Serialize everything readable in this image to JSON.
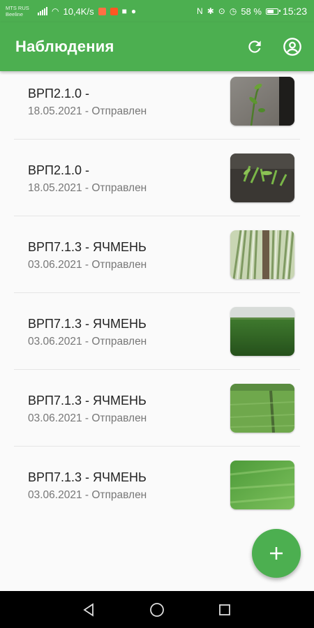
{
  "status_bar": {
    "carrier_line1": "MTS RUS",
    "carrier_line2": "Beeline",
    "network_speed": "10,4K/s",
    "battery_percent": "58 %",
    "time": "15:23",
    "icons": [
      "signal-icon",
      "wifi-icon",
      "notification-icon",
      "video-icon",
      "nfc-icon",
      "bluetooth-icon",
      "location-icon",
      "alarm-icon",
      "battery-icon"
    ]
  },
  "app_bar": {
    "title": "Наблюдения",
    "actions": [
      "refresh-icon",
      "account-icon"
    ]
  },
  "observations": [
    {
      "title": "ВРП2.1.0 -",
      "subtitle": "18.05.2021 - Отправлен",
      "thumbnail": "seedling-closeup-photo"
    },
    {
      "title": "ВРП2.1.0 -",
      "subtitle": "18.05.2021 - Отправлен",
      "thumbnail": "seedlings-soil-photo"
    },
    {
      "title": "ВРП7.1.3 - ЯЧМЕНЬ",
      "subtitle": "03.06.2021 - Отправлен",
      "thumbnail": "barley-rows-photo"
    },
    {
      "title": "ВРП7.1.3 - ЯЧМЕНЬ",
      "subtitle": "03.06.2021 - Отправлен",
      "thumbnail": "barley-field-horizon-photo"
    },
    {
      "title": "ВРП7.1.3 - ЯЧМЕНЬ",
      "subtitle": "03.06.2021 - Отправлен",
      "thumbnail": "barley-field-track-photo"
    },
    {
      "title": "ВРП7.1.3 - ЯЧМЕНЬ",
      "subtitle": "03.06.2021 - Отправлен",
      "thumbnail": "barley-closeup-photo"
    }
  ],
  "fab": {
    "icon": "plus-icon"
  },
  "nav_bar": {
    "buttons": [
      "back-icon",
      "home-icon",
      "recents-icon"
    ]
  },
  "colors": {
    "primary": "#4caf50",
    "text_primary": "#222222",
    "text_secondary": "#777777",
    "background": "#fafafa"
  }
}
